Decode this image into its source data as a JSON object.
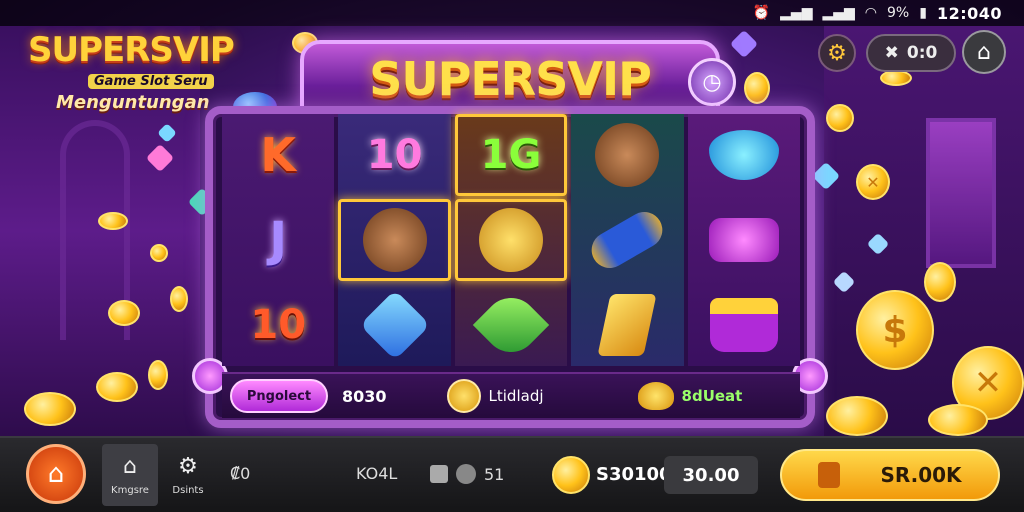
{
  "status_bar": {
    "icons": [
      "alarm-icon",
      "signal-icon",
      "signal-icon",
      "wifi-icon",
      "battery-icon"
    ],
    "battery_text": "9%",
    "time": "12:040"
  },
  "logo": {
    "title": "SUPERSVIP",
    "subtitle": "Game Slot Seru",
    "tagline": "Menguntungan"
  },
  "banner": {
    "title": "SUPERSVIP"
  },
  "top_controls": {
    "pill_value": "0:0"
  },
  "reels": [
    [
      {
        "kind": "text",
        "text": "K",
        "cls": "sym-k"
      },
      {
        "kind": "text",
        "text": "J",
        "cls": "sym-j"
      },
      {
        "kind": "text",
        "text": "10",
        "cls": "sym-10a"
      }
    ],
    [
      {
        "kind": "text",
        "text": "10",
        "cls": "sym-10b"
      },
      {
        "kind": "icon",
        "icon": "warrior-icon",
        "cls": "warrior",
        "hl": true
      },
      {
        "kind": "icon",
        "icon": "blue-gem-icon",
        "cls": "gem-blue"
      }
    ],
    [
      {
        "kind": "text",
        "text": "1G",
        "cls": "sym-10c",
        "hl": true
      },
      {
        "kind": "icon",
        "icon": "coins-icon",
        "cls": "coins",
        "hl": true
      },
      {
        "kind": "icon",
        "icon": "green-gem-icon",
        "cls": "gem-green"
      }
    ],
    [
      {
        "kind": "icon",
        "icon": "warrior-icon",
        "cls": "warrior"
      },
      {
        "kind": "icon",
        "icon": "scroll-icon",
        "cls": "scroll"
      },
      {
        "kind": "icon",
        "icon": "gold-gem-icon",
        "cls": "gem-gold"
      }
    ],
    [
      {
        "kind": "icon",
        "icon": "blue-shield-icon",
        "cls": "shield-blue"
      },
      {
        "kind": "icon",
        "icon": "charm-icon",
        "cls": "charm"
      },
      {
        "kind": "icon",
        "icon": "treasure-chest-icon",
        "cls": "chest"
      }
    ]
  ],
  "info_bar": {
    "button_label": "Pngolect",
    "value": "8030",
    "label": "Ltidladj",
    "label2": "8dUeat"
  },
  "bottom_bar": {
    "tab1_label": "Kmgsre",
    "tab2_label": "Dsints",
    "text1": "₡0",
    "text2": "KO4L",
    "text3": "51",
    "balance": "S30100",
    "bet": "30.00",
    "spin_label": "SR.00K"
  }
}
